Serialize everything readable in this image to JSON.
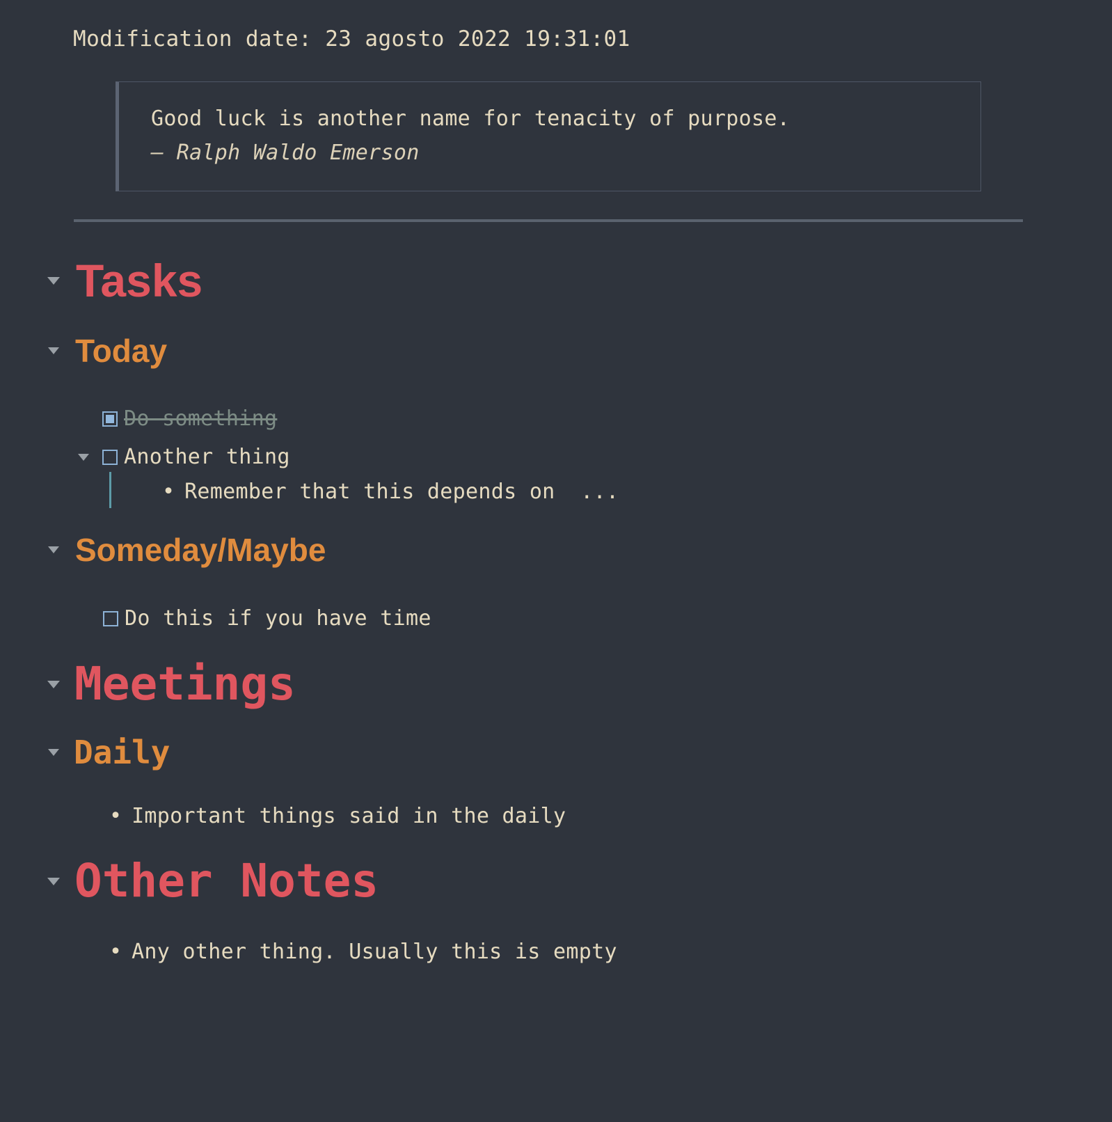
{
  "document": {
    "modification_date_label": "Modification date: 23 agosto 2022 19:31:01"
  },
  "quote": {
    "text": "Good luck is another name for tenacity of purpose.",
    "attribution": "— Ralph Waldo Emerson"
  },
  "outline": {
    "tasks_heading": "Tasks",
    "today_heading": "Today",
    "task_do_something": "Do something",
    "task_another_thing": "Another thing",
    "note_remember": "Remember that this depends on  ...",
    "someday_heading": "Someday/Maybe",
    "task_do_this_if_time": "Do this if you have time",
    "meetings_heading": "Meetings",
    "daily_heading": "Daily",
    "note_daily": "Important things said in the daily",
    "other_notes_heading": "Other Notes",
    "note_other": "Any other thing. Usually this is empty"
  },
  "icons": {
    "caret": "collapse-triangle",
    "bullet": "•"
  },
  "colors": {
    "background": "#2f343d",
    "text": "#e6dbc0",
    "heading_level1": "#e0565f",
    "heading_level2": "#e08c3e",
    "checkbox": "#8db2d6",
    "done_text": "#7d8c85",
    "rule": "#5a626e",
    "indent_guide": "#5d9ca8"
  }
}
